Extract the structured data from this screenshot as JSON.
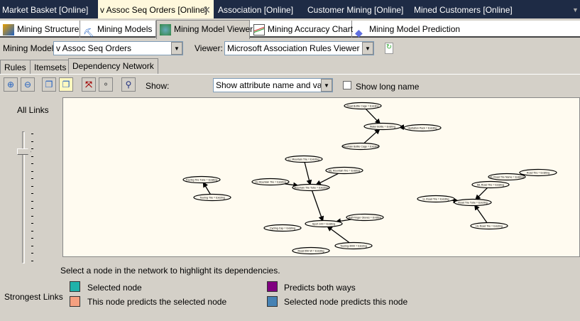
{
  "doc_tabs": [
    "Market Basket [Online]",
    "v Assoc Seq Orders [Online]",
    "Association [Online]",
    "Customer Mining [Online]",
    "Mined Customers [Online]"
  ],
  "designer_tabs": [
    "Mining Structure",
    "Mining Models",
    "Mining Model Viewer",
    "Mining Accuracy Chart",
    "Mining Model Prediction"
  ],
  "mining_model_label": "Mining Model:",
  "mining_model_value": "v Assoc Seq Orders",
  "viewer_label": "Viewer:",
  "viewer_value": "Microsoft Association Rules Viewer",
  "sub_tabs": [
    "Rules",
    "Itemsets",
    "Dependency Network"
  ],
  "show_label": "Show:",
  "show_value": "Show attribute name and value",
  "show_long_name": "Show long name",
  "all_links": "All Links",
  "strongest_links": "Strongest Links",
  "hint": "Select a node in the network to highlight its dependencies.",
  "legend": [
    {
      "label": "Selected node",
      "color": "#20b2aa"
    },
    {
      "label": "This node predicts the selected node",
      "color": "#f4a080"
    },
    {
      "label": "Predicts both ways",
      "color": "#800080"
    },
    {
      "label": "Selected node predicts this node",
      "color": "#4682b4"
    }
  ],
  "slider_value": 0.87,
  "nodes": [
    "Road Bottle Cage = Existing",
    "Water Bottle = Existing",
    "Hydration Pack = Existing",
    "Mountain Bottle Cage = Existing",
    "Touring Tire Tube = Existing",
    "Touring Tire = Existing",
    "LL Mountain Tire = Existing",
    "ML Mountain Tire = Existing",
    "HL Mountain Tire = Existing",
    "Mountain Tire Tube = Existing",
    "Sport-100 = Existing",
    "Half-Finger Gloves = Existing",
    "Cycling Cap = Existing",
    "Touring-3000 = Existing",
    "Road-550-W = Existing",
    "Road Tire = Existing",
    "HL Road Tire Name = Existing",
    "ML Road Tire = Existing",
    "LL Road Tire = Existing",
    "Road Tire Tube = Existing",
    "HL Road Tire = Existing"
  ],
  "edges": [
    [
      0,
      1
    ],
    [
      3,
      1
    ],
    [
      2,
      1
    ],
    [
      5,
      4
    ],
    [
      6,
      9
    ],
    [
      8,
      9
    ],
    [
      7,
      9
    ],
    [
      9,
      10
    ],
    [
      11,
      10
    ],
    [
      13,
      10
    ],
    [
      15,
      16
    ],
    [
      17,
      19
    ],
    [
      18,
      19
    ],
    [
      20,
      19
    ]
  ]
}
